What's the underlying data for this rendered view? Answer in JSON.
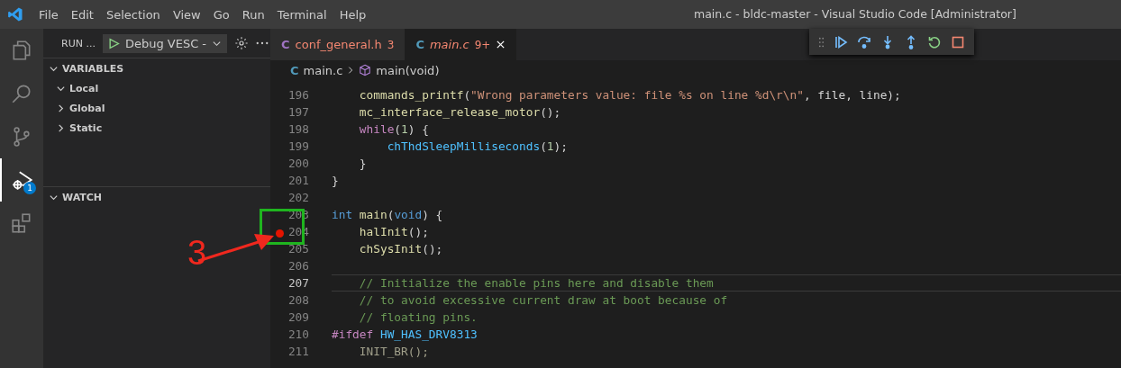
{
  "title_bar": {
    "menu": [
      "File",
      "Edit",
      "Selection",
      "View",
      "Go",
      "Run",
      "Terminal",
      "Help"
    ],
    "title": "main.c - bldc-master - Visual Studio Code [Administrator]"
  },
  "activity_bar": [
    {
      "kind": "files",
      "selected": false
    },
    {
      "kind": "search",
      "selected": false
    },
    {
      "kind": "source-control",
      "selected": false
    },
    {
      "kind": "debug",
      "selected": true,
      "badge": "1"
    },
    {
      "kind": "extensions",
      "selected": false
    }
  ],
  "sidebar": {
    "run_label": "RUN ...",
    "configuration": "Debug VESC -",
    "sections": [
      {
        "title": "VARIABLES",
        "expanded": true,
        "children": [
          {
            "label": "Local",
            "expanded": true
          },
          {
            "label": "Global",
            "expanded": false
          },
          {
            "label": "Static",
            "expanded": false
          }
        ]
      },
      {
        "title": "WATCH",
        "expanded": true
      }
    ]
  },
  "tabs": [
    {
      "icon": "C",
      "label": "conf_general.h",
      "problems": "3",
      "selected": false,
      "preview": false
    },
    {
      "icon": "C",
      "label": "main.c",
      "problems": "9+",
      "selected": true,
      "preview": true
    }
  ],
  "breadcrumb": [
    {
      "kind": "file",
      "icon": "C",
      "label": "main.c"
    },
    {
      "kind": "function",
      "label": "main(void)"
    }
  ],
  "debug_toolbar": [
    {
      "kind": "continue"
    },
    {
      "kind": "step-over"
    },
    {
      "kind": "step-into"
    },
    {
      "kind": "step-out"
    },
    {
      "kind": "restart"
    },
    {
      "kind": "stop"
    }
  ],
  "lines": [
    {
      "number": "196",
      "current": false,
      "breakpoint": false,
      "tokens": [
        {
          "text": "    commands_printf",
          "kind": "fn"
        },
        {
          "text": "(",
          "kind": "plain"
        },
        {
          "text": "\"Wrong parameters value: file %s on line %d\\r\\n\"",
          "kind": "string"
        },
        {
          "text": ", file, line);",
          "kind": "plain"
        }
      ]
    },
    {
      "number": "197",
      "current": false,
      "breakpoint": false,
      "tokens": [
        {
          "text": "    mc_interface_release_motor",
          "kind": "fn"
        },
        {
          "text": "();",
          "kind": "plain"
        }
      ]
    },
    {
      "number": "198",
      "current": false,
      "breakpoint": false,
      "tokens": [
        {
          "text": "    while",
          "kind": "control"
        },
        {
          "text": "(",
          "kind": "plain"
        },
        {
          "text": "1",
          "kind": "number"
        },
        {
          "text": ") {",
          "kind": "plain"
        }
      ]
    },
    {
      "number": "199",
      "current": false,
      "breakpoint": false,
      "tokens": [
        {
          "text": "        chThdSleepMilliseconds",
          "kind": "macro"
        },
        {
          "text": "(",
          "kind": "plain"
        },
        {
          "text": "1",
          "kind": "number"
        },
        {
          "text": ");",
          "kind": "plain"
        }
      ]
    },
    {
      "number": "200",
      "current": false,
      "breakpoint": false,
      "tokens": [
        {
          "text": "    }",
          "kind": "plain"
        }
      ]
    },
    {
      "number": "201",
      "current": false,
      "breakpoint": false,
      "tokens": [
        {
          "text": "}",
          "kind": "plain"
        }
      ]
    },
    {
      "number": "202",
      "current": false,
      "breakpoint": false
    },
    {
      "number": "203",
      "current": false,
      "breakpoint": false,
      "tokens": [
        {
          "text": "int",
          "kind": "keyword"
        },
        {
          "text": " main",
          "kind": "fn"
        },
        {
          "text": "(",
          "kind": "plain"
        },
        {
          "text": "void",
          "kind": "keyword"
        },
        {
          "text": ") {",
          "kind": "plain"
        }
      ]
    },
    {
      "number": "204",
      "current": false,
      "breakpoint": true,
      "tokens": [
        {
          "text": "    halInit",
          "kind": "fn"
        },
        {
          "text": "();",
          "kind": "plain"
        }
      ]
    },
    {
      "number": "205",
      "current": false,
      "breakpoint": false,
      "tokens": [
        {
          "text": "    chSysInit",
          "kind": "fn"
        },
        {
          "text": "();",
          "kind": "plain"
        }
      ]
    },
    {
      "number": "206",
      "current": false,
      "breakpoint": false
    },
    {
      "number": "207",
      "current": true,
      "breakpoint": false,
      "tokens": [
        {
          "text": "    // Initialize the enable pins here and disable them",
          "kind": "comment"
        }
      ]
    },
    {
      "number": "208",
      "current": false,
      "breakpoint": false,
      "tokens": [
        {
          "text": "    // to avoid excessive current draw at boot because of",
          "kind": "comment"
        }
      ]
    },
    {
      "number": "209",
      "current": false,
      "breakpoint": false,
      "tokens": [
        {
          "text": "    // floating pins.",
          "kind": "comment"
        }
      ]
    },
    {
      "number": "210",
      "current": false,
      "breakpoint": false,
      "tokens": [
        {
          "text": "#ifdef",
          "kind": "control"
        },
        {
          "text": " HW_HAS_DRV8313",
          "kind": "macro"
        }
      ]
    },
    {
      "number": "211",
      "current": false,
      "breakpoint": false,
      "tokens": [
        {
          "text": "    INIT_BR();",
          "kind": "inactive"
        }
      ]
    }
  ],
  "annotation": {
    "label": "3"
  }
}
